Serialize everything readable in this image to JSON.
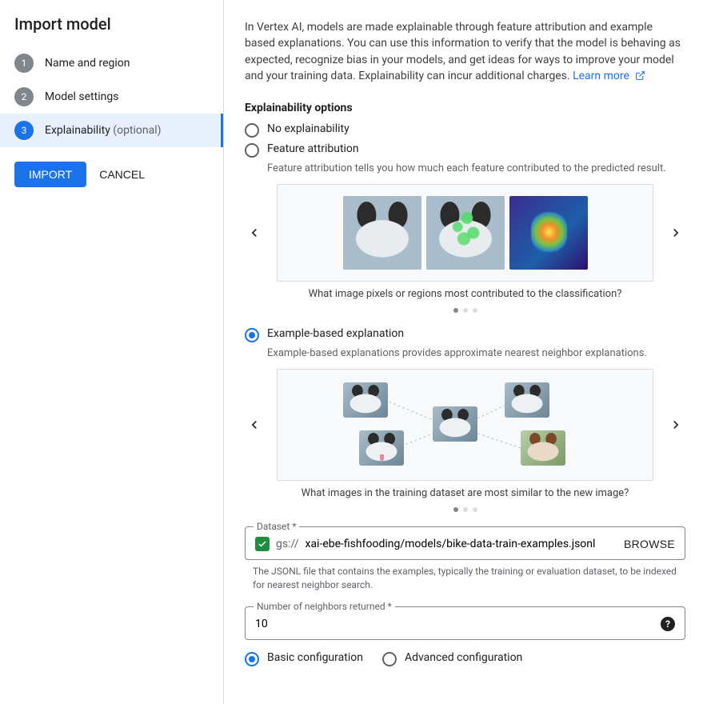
{
  "sidebar": {
    "title": "Import model",
    "steps": [
      {
        "num": "1",
        "label": "Name and region"
      },
      {
        "num": "2",
        "label": "Model settings"
      },
      {
        "num": "3",
        "label": "Explainability",
        "optional": "(optional)"
      }
    ],
    "import_btn": "IMPORT",
    "cancel_btn": "CANCEL"
  },
  "main": {
    "intro": "In Vertex AI, models are made explainable through feature attribution and example based explanations. You can use this information to verify that the model is behaving as expected, recognize bias in your models, and get ideas for ways to improve your model and your training data. Explainability can incur additional charges. ",
    "learn_more": "Learn more",
    "options_heading": "Explainability options",
    "no_exp_label": "No explainability",
    "feat_attr_label": "Feature attribution",
    "feat_attr_sub": "Feature attribution tells you how much each feature contributed to the predicted result.",
    "feat_caption": "What image pixels or regions most contributed to the classification?",
    "example_label": "Example-based explanation",
    "example_sub": "Example-based explanations provides approximate nearest neighbor explanations.",
    "example_caption": "What images in the training dataset are most similar to the new image?",
    "dataset": {
      "label": "Dataset *",
      "prefix": "gs://",
      "value": "xai-ebe-fishfooding/models/bike-data-train-examples.jsonl",
      "browse": "BROWSE",
      "helper": "The JSONL file that contains the examples, typically the training or evaluation dataset, to be indexed for nearest neighbor search."
    },
    "neighbors": {
      "label": "Number of neighbors returned *",
      "value": "10"
    },
    "basic_label": "Basic configuration",
    "advanced_label": "Advanced configuration"
  }
}
